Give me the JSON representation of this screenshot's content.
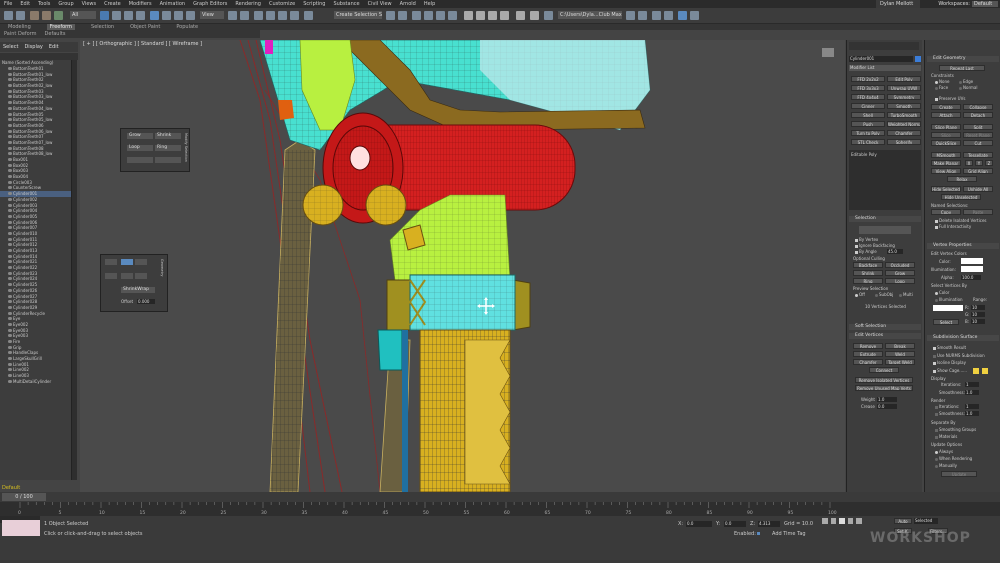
{
  "menu": [
    "File",
    "Edit",
    "Tools",
    "Group",
    "Views",
    "Create",
    "Modifiers",
    "Animation",
    "Graph Editors",
    "Rendering",
    "Customize",
    "Scripting",
    "Substance",
    "Civil View",
    "Arnold",
    "Help"
  ],
  "user": "Dylan Mellott",
  "workspaces_label": "Workspaces:",
  "workspace": "Default",
  "toolbar": {
    "all_filter": "All",
    "view_dropdown": "View",
    "selection_set": "Create Selection Se",
    "path": "C:\\Users\\Dyla...Club Max 2021"
  },
  "ribbon_tabs": [
    "Modeling",
    "Freeform",
    "Selection",
    "Object Paint",
    "Populate"
  ],
  "ribbon_active": "Freeform",
  "ribbon_sub": [
    "Paint Deform",
    "Defaults"
  ],
  "left_tabs": [
    "Select",
    "Display",
    "Edit"
  ],
  "explorer_header": "Name (Sorted Ascending)",
  "explorer_items": [
    "BottomTeeth01",
    "BottomTeeth01_low",
    "BottomTeeth02",
    "BottomTeeth02_low",
    "BottomTeeth03",
    "BottomTeeth03_low",
    "BottomTeeth04",
    "BottomTeeth04_low",
    "BottomTeeth05",
    "BottomTeeth05_low",
    "BottomTeeth06",
    "BottomTeeth06_low",
    "BottomTeeth07",
    "BottomTeeth07_low",
    "BottomTeeth08",
    "BottomTeeth08_low",
    "Box001",
    "Box002",
    "Box003",
    "Box004",
    "Circle003",
    "CounterScrew",
    "Cylinder001",
    "Cylinder002",
    "Cylinder003",
    "Cylinder004",
    "Cylinder005",
    "Cylinder006",
    "Cylinder007",
    "Cylinder010",
    "Cylinder011",
    "Cylinder012",
    "Cylinder013",
    "Cylinder014",
    "Cylinder021",
    "Cylinder022",
    "Cylinder023",
    "Cylinder024",
    "Cylinder025",
    "Cylinder026",
    "Cylinder027",
    "Cylinder028",
    "Cylinder029",
    "CylinderRecycle",
    "Eye",
    "Eye002",
    "Eye003",
    "Eye003",
    "Fire",
    "Grip",
    "HandleClaps",
    "LargeSkullGrill",
    "Line001",
    "Line002",
    "Line003",
    "MultiDetailCylinder"
  ],
  "explorer_selected_index": 22,
  "viewport_label": "[ + ] [ Orthographic ] [ Standard ] [ Wireframe ]",
  "float_panel_1": {
    "grow": "Grow",
    "shrink": "Shrink",
    "loop": "Loop",
    "ring": "Ring",
    "side_label": "Modify Selection"
  },
  "float_panel_2": {
    "shrinkwrap": "ShrinkWrap",
    "offset_label": "Offset",
    "offset_value": "0.000",
    "side_label": "Geometry"
  },
  "command_panel": {
    "object_name": "Cylinder001",
    "modifier_list": "Modifier List",
    "buttons": [
      "FFD 2x2x2",
      "Edit Poly",
      "FFD 3x3x3",
      "Unwrap UVW",
      "FFD 4x4x4",
      "Symmetry",
      "Cinner",
      "Smooth",
      "Shell",
      "TurboSmooth",
      "Push",
      "Weighted Normals",
      "Turn to Poly",
      "Chamfer",
      "STL Check",
      "Spherify"
    ],
    "stack_item": "Editable Poly",
    "selection_title": "Selection",
    "by_vertex": "By Vertex",
    "ignore_backfacing": "Ignore Backfacing",
    "by_angle": "By Angle",
    "by_angle_value": "45.0",
    "optional_culling": "Optional Culling",
    "backface": "Backface",
    "occluded": "Occluded",
    "shrink": "Shrink",
    "grow": "Grow",
    "ring": "Ring",
    "loop": "Loop",
    "preview_selection": "Preview Selection",
    "preview_off": "Off",
    "preview_subobj": "SubObj",
    "preview_multi": "Multi",
    "status": "10 Vertices Selected",
    "soft_selection": "Soft Selection",
    "edit_vertices": "Edit Vertices",
    "ev_buttons": [
      "Remove",
      "Break",
      "Extrude",
      "Weld",
      "Chamfer",
      "Target Weld",
      "Connect"
    ],
    "remove_isolated": "Remove Isolated Vertices",
    "remove_unused": "Remove Unused Map Verts",
    "weight_label": "Weight",
    "weight_value": "1.0",
    "crease_label": "Crease",
    "crease_value": "0.0"
  },
  "right_panel": {
    "edit_geometry": "Edit Geometry",
    "repeat_last": "Repeat Last",
    "constraints": "Constraints",
    "none": "None",
    "edge": "Edge",
    "face": "Face",
    "normal": "Normal",
    "preserve_uvs": "Preserve UVs",
    "create": "Create",
    "collapse": "Collapse",
    "attach": "Attach",
    "detach": "Detach",
    "slice_plane": "Slice Plane",
    "split": "Split",
    "slice": "Slice",
    "reset_plane": "Reset Plane",
    "quickslice": "QuickSlice",
    "cut": "Cut",
    "msmooth": "MSmooth",
    "tessellate": "Tessellate",
    "make_planar": "Make Planar",
    "x": "X",
    "y": "Y",
    "z": "Z",
    "view_align": "View Align",
    "grid_align": "Grid Align",
    "relax": "Relax",
    "hide_selected": "Hide Selected",
    "unhide_all": "Unhide All",
    "hide_unselected": "Hide Unselected",
    "named_selections": "Named Selections:",
    "copy": "Copy",
    "paste": "Paste",
    "delete_isolated": "Delete Isolated Vertices",
    "full_interactivity": "Full Interactivity",
    "vertex_properties": "Vertex Properties",
    "edit_vertex_colors": "Edit Vertex Colors",
    "color": "Color:",
    "illumination": "Illumination:",
    "alpha": "Alpha:",
    "alpha_value": "100.0",
    "select_vertices_by": "Select Vertices By",
    "by_color": "Color",
    "by_illum": "Illumination",
    "range": "Range:",
    "r": "R:",
    "g": "G:",
    "b": "B:",
    "range_value": "10",
    "select": "Select",
    "subdivision_surface": "Subdivision Surface",
    "smooth_result": "Smooth Result",
    "use_nurms": "Use NURMS Subdivision",
    "isoline_display": "Isoline Display",
    "show_cage": "Show Cage......",
    "display": "Display",
    "iterations": "Iterations:",
    "smoothness": "Smoothness:",
    "iter_value": "1",
    "smooth_value": "1.0",
    "render": "Render",
    "separate_by": "Separate By",
    "smoothing_groups": "Smoothing Groups",
    "materials": "Materials",
    "update_options": "Update Options",
    "always": "Always",
    "when_rendering": "When Rendering",
    "manually": "Manually",
    "update": "Update"
  },
  "timeline": {
    "frame": "0 / 100",
    "ticks": [
      "0",
      "5",
      "10",
      "15",
      "20",
      "25",
      "30",
      "35",
      "40",
      "45",
      "50",
      "55",
      "60",
      "65",
      "70",
      "75",
      "80",
      "85",
      "90",
      "95",
      "100"
    ]
  },
  "status": {
    "objects_selected": "1 Object Selected",
    "hint": "Click or click-and-drag to select objects",
    "x_label": "X:",
    "x_value": "0.0",
    "y_label": "Y:",
    "y_value": "0.0",
    "z_label": "Z:",
    "z_value": "4.313",
    "grid": "Grid = 10.0",
    "enabled": "Enabled:",
    "add_time_tag": "Add Time Tag",
    "auto": "Auto",
    "selected": "Selected",
    "set_k": "Set K.",
    "filters": "Filters..."
  },
  "default_label": "Default",
  "watermark": "WORKSHOP"
}
